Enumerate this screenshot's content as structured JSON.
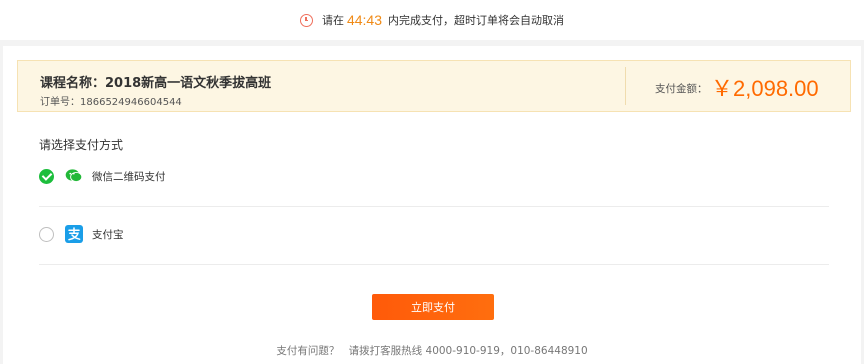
{
  "timer": {
    "prefix": "请在",
    "countdown": "44:43",
    "suffix": "内完成支付，超时订单将会自动取消",
    "icon": "clock-icon"
  },
  "order": {
    "course_name": "课程名称：2018新高一语文秋季拔高班",
    "order_no": "订单号：1866524946604544",
    "amount_label": "支付金额：",
    "amount": "￥2,098.00"
  },
  "payment": {
    "title": "请选择支付方式",
    "options": [
      {
        "label": "微信二维码支付",
        "icon": "wechat-pay-icon",
        "selected": true
      },
      {
        "label": "支付宝",
        "icon": "alipay-icon",
        "selected": false
      }
    ],
    "submit_label": "立即支付"
  },
  "footer": {
    "question": "支付有问题？",
    "hotline": "请拨打客服热线 4000-910-919，010-86448910"
  },
  "colors": {
    "accent": "#ff6a00",
    "timer": "#f08a16",
    "selected": "#1cbe3c",
    "wechat": "#22b838",
    "alipay": "#1a9ee8"
  }
}
